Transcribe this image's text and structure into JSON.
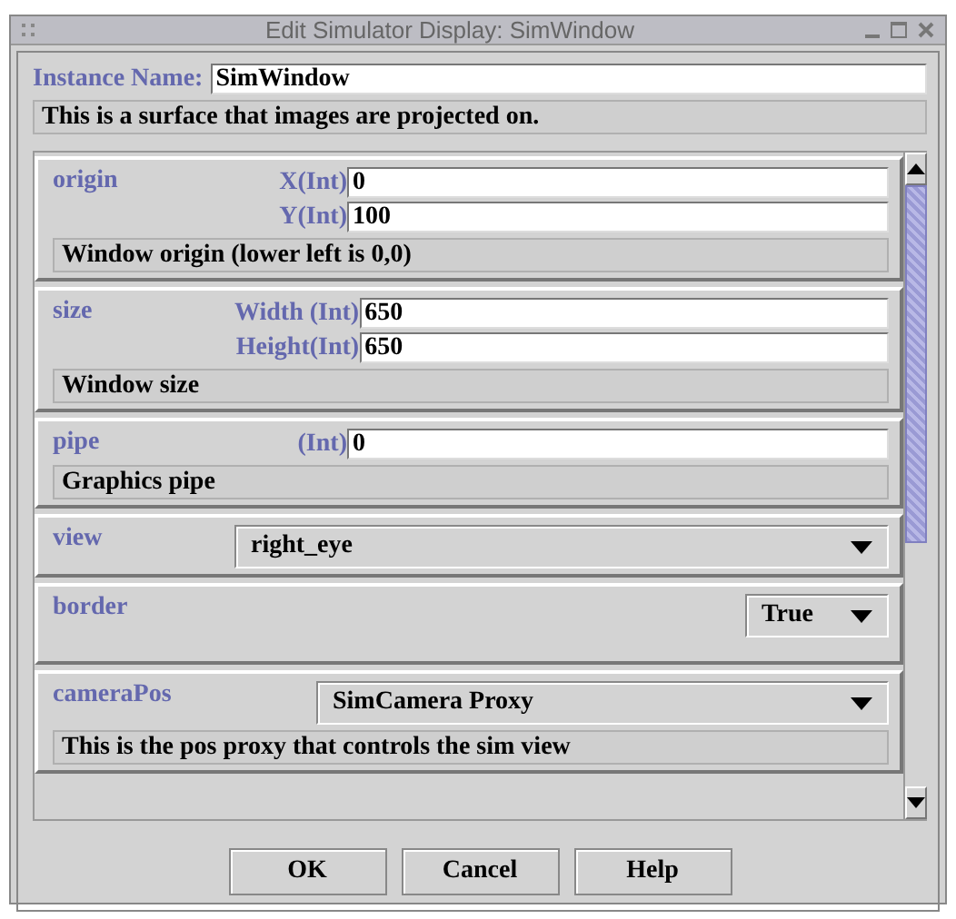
{
  "window": {
    "title": "Edit Simulator Display: SimWindow"
  },
  "instance": {
    "label": "Instance Name:",
    "value": "SimWindow",
    "description": "This is a surface that images are projected on."
  },
  "sections": [
    {
      "kind": "fields",
      "name": "origin",
      "fields": [
        {
          "label": "X(Int)",
          "value": "0"
        },
        {
          "label": "Y(Int)",
          "value": "100"
        }
      ],
      "description": "Window origin (lower left is 0,0)"
    },
    {
      "kind": "fields",
      "name": "size",
      "fields": [
        {
          "label": "Width (Int)",
          "value": "650"
        },
        {
          "label": "Height(Int)",
          "value": "650"
        }
      ],
      "description": "Window size"
    },
    {
      "kind": "fields",
      "name": "pipe",
      "fields": [
        {
          "label": "(Int)",
          "value": "0"
        }
      ],
      "description": "Graphics pipe"
    },
    {
      "kind": "choice",
      "name": "view",
      "value": "right_eye"
    },
    {
      "kind": "toggle",
      "name": "border",
      "value": "True"
    },
    {
      "kind": "proxy",
      "name": "cameraPos",
      "value": "SimCamera Proxy",
      "description": "This is the pos proxy that controls the sim view"
    }
  ],
  "buttons": [
    "OK",
    "Cancel",
    "Help"
  ]
}
